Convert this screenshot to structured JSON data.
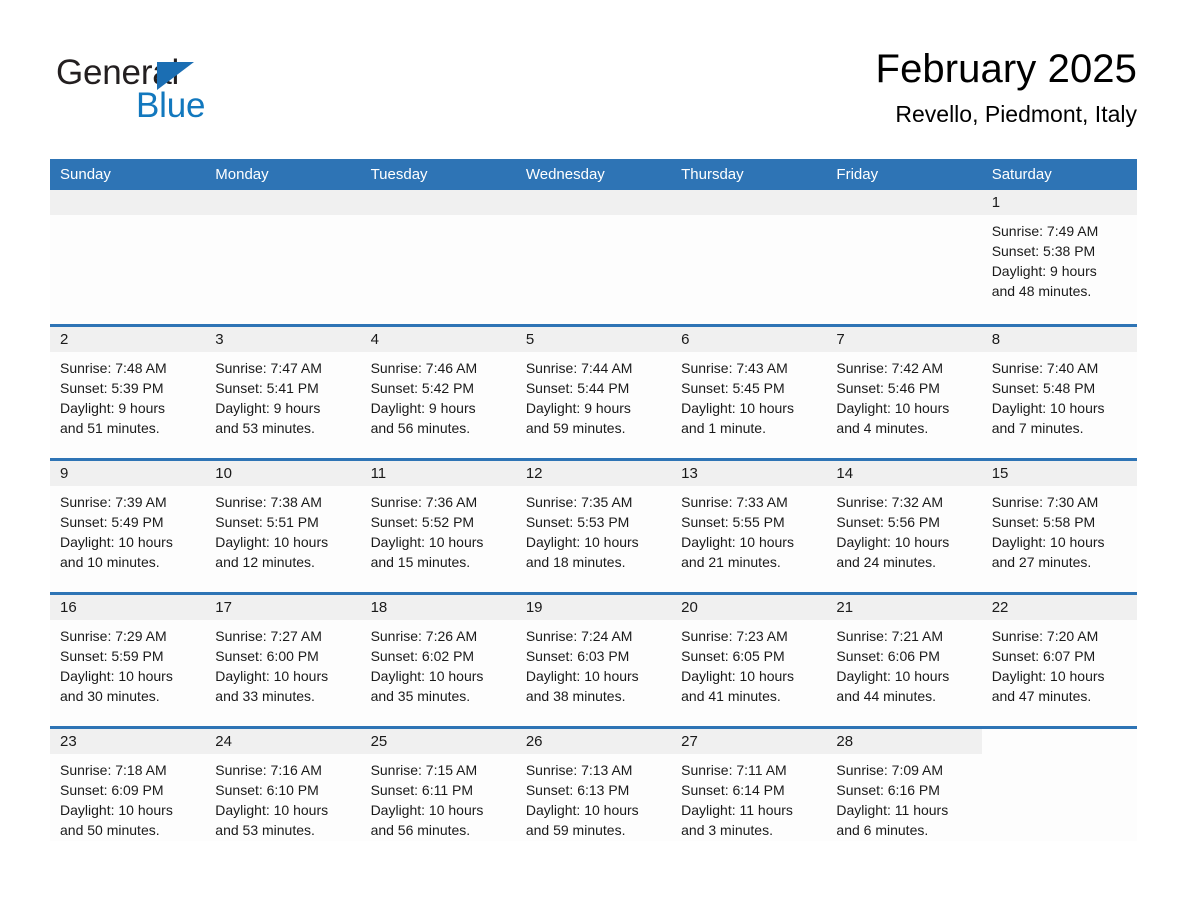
{
  "brand": {
    "name_part1": "General",
    "name_part2": "Blue",
    "triangle_icon": "triangle-logo-icon"
  },
  "header": {
    "title": "February 2025",
    "location": "Revello, Piedmont, Italy"
  },
  "colors": {
    "header_blue": "#2e74b5",
    "brand_blue": "#1278be",
    "day_band_gray": "#f0f0f0",
    "text": "#1a1a1a"
  },
  "day_headers": [
    "Sunday",
    "Monday",
    "Tuesday",
    "Wednesday",
    "Thursday",
    "Friday",
    "Saturday"
  ],
  "weeks": [
    [
      {
        "empty": true
      },
      {
        "empty": true
      },
      {
        "empty": true
      },
      {
        "empty": true
      },
      {
        "empty": true
      },
      {
        "empty": true
      },
      {
        "day": "1",
        "sunrise": "Sunrise: 7:49 AM",
        "sunset": "Sunset: 5:38 PM",
        "daylight1": "Daylight: 9 hours",
        "daylight2": "and 48 minutes."
      }
    ],
    [
      {
        "day": "2",
        "sunrise": "Sunrise: 7:48 AM",
        "sunset": "Sunset: 5:39 PM",
        "daylight1": "Daylight: 9 hours",
        "daylight2": "and 51 minutes."
      },
      {
        "day": "3",
        "sunrise": "Sunrise: 7:47 AM",
        "sunset": "Sunset: 5:41 PM",
        "daylight1": "Daylight: 9 hours",
        "daylight2": "and 53 minutes."
      },
      {
        "day": "4",
        "sunrise": "Sunrise: 7:46 AM",
        "sunset": "Sunset: 5:42 PM",
        "daylight1": "Daylight: 9 hours",
        "daylight2": "and 56 minutes."
      },
      {
        "day": "5",
        "sunrise": "Sunrise: 7:44 AM",
        "sunset": "Sunset: 5:44 PM",
        "daylight1": "Daylight: 9 hours",
        "daylight2": "and 59 minutes."
      },
      {
        "day": "6",
        "sunrise": "Sunrise: 7:43 AM",
        "sunset": "Sunset: 5:45 PM",
        "daylight1": "Daylight: 10 hours",
        "daylight2": "and 1 minute."
      },
      {
        "day": "7",
        "sunrise": "Sunrise: 7:42 AM",
        "sunset": "Sunset: 5:46 PM",
        "daylight1": "Daylight: 10 hours",
        "daylight2": "and 4 minutes."
      },
      {
        "day": "8",
        "sunrise": "Sunrise: 7:40 AM",
        "sunset": "Sunset: 5:48 PM",
        "daylight1": "Daylight: 10 hours",
        "daylight2": "and 7 minutes."
      }
    ],
    [
      {
        "day": "9",
        "sunrise": "Sunrise: 7:39 AM",
        "sunset": "Sunset: 5:49 PM",
        "daylight1": "Daylight: 10 hours",
        "daylight2": "and 10 minutes."
      },
      {
        "day": "10",
        "sunrise": "Sunrise: 7:38 AM",
        "sunset": "Sunset: 5:51 PM",
        "daylight1": "Daylight: 10 hours",
        "daylight2": "and 12 minutes."
      },
      {
        "day": "11",
        "sunrise": "Sunrise: 7:36 AM",
        "sunset": "Sunset: 5:52 PM",
        "daylight1": "Daylight: 10 hours",
        "daylight2": "and 15 minutes."
      },
      {
        "day": "12",
        "sunrise": "Sunrise: 7:35 AM",
        "sunset": "Sunset: 5:53 PM",
        "daylight1": "Daylight: 10 hours",
        "daylight2": "and 18 minutes."
      },
      {
        "day": "13",
        "sunrise": "Sunrise: 7:33 AM",
        "sunset": "Sunset: 5:55 PM",
        "daylight1": "Daylight: 10 hours",
        "daylight2": "and 21 minutes."
      },
      {
        "day": "14",
        "sunrise": "Sunrise: 7:32 AM",
        "sunset": "Sunset: 5:56 PM",
        "daylight1": "Daylight: 10 hours",
        "daylight2": "and 24 minutes."
      },
      {
        "day": "15",
        "sunrise": "Sunrise: 7:30 AM",
        "sunset": "Sunset: 5:58 PM",
        "daylight1": "Daylight: 10 hours",
        "daylight2": "and 27 minutes."
      }
    ],
    [
      {
        "day": "16",
        "sunrise": "Sunrise: 7:29 AM",
        "sunset": "Sunset: 5:59 PM",
        "daylight1": "Daylight: 10 hours",
        "daylight2": "and 30 minutes."
      },
      {
        "day": "17",
        "sunrise": "Sunrise: 7:27 AM",
        "sunset": "Sunset: 6:00 PM",
        "daylight1": "Daylight: 10 hours",
        "daylight2": "and 33 minutes."
      },
      {
        "day": "18",
        "sunrise": "Sunrise: 7:26 AM",
        "sunset": "Sunset: 6:02 PM",
        "daylight1": "Daylight: 10 hours",
        "daylight2": "and 35 minutes."
      },
      {
        "day": "19",
        "sunrise": "Sunrise: 7:24 AM",
        "sunset": "Sunset: 6:03 PM",
        "daylight1": "Daylight: 10 hours",
        "daylight2": "and 38 minutes."
      },
      {
        "day": "20",
        "sunrise": "Sunrise: 7:23 AM",
        "sunset": "Sunset: 6:05 PM",
        "daylight1": "Daylight: 10 hours",
        "daylight2": "and 41 minutes."
      },
      {
        "day": "21",
        "sunrise": "Sunrise: 7:21 AM",
        "sunset": "Sunset: 6:06 PM",
        "daylight1": "Daylight: 10 hours",
        "daylight2": "and 44 minutes."
      },
      {
        "day": "22",
        "sunrise": "Sunrise: 7:20 AM",
        "sunset": "Sunset: 6:07 PM",
        "daylight1": "Daylight: 10 hours",
        "daylight2": "and 47 minutes."
      }
    ],
    [
      {
        "day": "23",
        "sunrise": "Sunrise: 7:18 AM",
        "sunset": "Sunset: 6:09 PM",
        "daylight1": "Daylight: 10 hours",
        "daylight2": "and 50 minutes."
      },
      {
        "day": "24",
        "sunrise": "Sunrise: 7:16 AM",
        "sunset": "Sunset: 6:10 PM",
        "daylight1": "Daylight: 10 hours",
        "daylight2": "and 53 minutes."
      },
      {
        "day": "25",
        "sunrise": "Sunrise: 7:15 AM",
        "sunset": "Sunset: 6:11 PM",
        "daylight1": "Daylight: 10 hours",
        "daylight2": "and 56 minutes."
      },
      {
        "day": "26",
        "sunrise": "Sunrise: 7:13 AM",
        "sunset": "Sunset: 6:13 PM",
        "daylight1": "Daylight: 10 hours",
        "daylight2": "and 59 minutes."
      },
      {
        "day": "27",
        "sunrise": "Sunrise: 7:11 AM",
        "sunset": "Sunset: 6:14 PM",
        "daylight1": "Daylight: 11 hours",
        "daylight2": "and 3 minutes."
      },
      {
        "day": "28",
        "sunrise": "Sunrise: 7:09 AM",
        "sunset": "Sunset: 6:16 PM",
        "daylight1": "Daylight: 11 hours",
        "daylight2": "and 6 minutes."
      },
      {
        "blank": true
      }
    ]
  ]
}
